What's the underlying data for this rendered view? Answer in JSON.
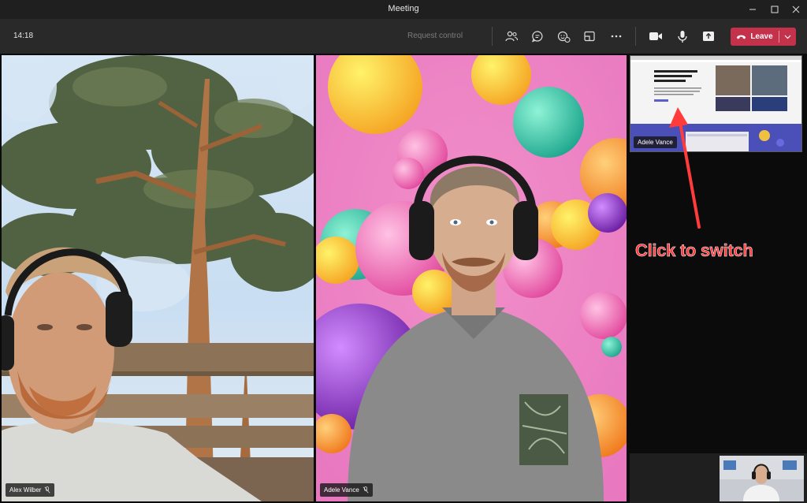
{
  "window": {
    "title": "Meeting"
  },
  "toolbar": {
    "time": "14:18",
    "request_control": "Request control",
    "leave_label": "Leave",
    "icons": [
      "people-icon",
      "chat-icon",
      "reactions-icon",
      "rooms-icon",
      "more-icon",
      "camera-icon",
      "mic-icon",
      "share-icon",
      "phone-icon",
      "chevron-down-icon"
    ]
  },
  "participants": [
    {
      "name": "Alex Wilber",
      "muted": true
    },
    {
      "name": "Adele Vance",
      "muted": true
    }
  ],
  "screen_share": {
    "presenter": "Adele Vance"
  },
  "annotation": {
    "text": "Click to switch"
  },
  "colors": {
    "leave": "#c4314b",
    "annotation": "#ff3b3b",
    "toolbar": "#292929",
    "titlebar": "#1f1f1f"
  }
}
